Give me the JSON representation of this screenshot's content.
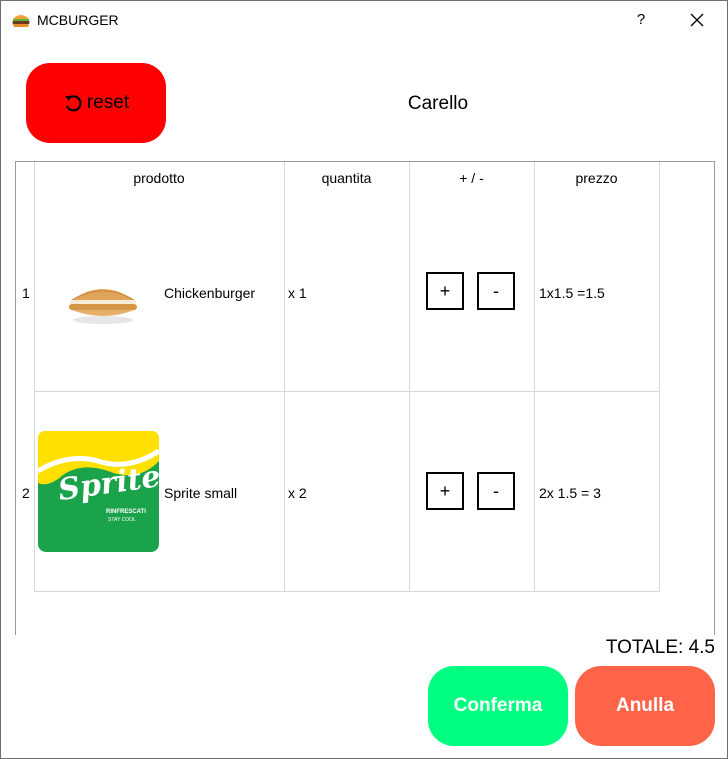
{
  "window": {
    "title": "MCBURGER",
    "help_label": "?",
    "icon": "burger-icon"
  },
  "header": {
    "reset_label": "reset",
    "reset_icon": "rotate-ccw-icon",
    "cart_title": "Carello"
  },
  "table": {
    "columns": [
      "prodotto",
      "quantita",
      "+ / -",
      "prezzo"
    ],
    "rows": [
      {
        "num": "1",
        "name": "Chickenburger",
        "image": "chicken-burger-image",
        "qty": "x 1",
        "plus": "+",
        "minus": "-",
        "price": "1x1.5 =1.5"
      },
      {
        "num": "2",
        "name": "Sprite small",
        "image": "sprite-can-image",
        "image_text": [
          "Sprite",
          "RINFRESCATI",
          "STAY COOL"
        ],
        "qty": "x 2",
        "plus": "+",
        "minus": "-",
        "price": "2x 1.5 = 3"
      }
    ]
  },
  "footer": {
    "total": "TOTALE: 4.5",
    "confirm_label": "Conferma",
    "cancel_label": "Anulla"
  },
  "colors": {
    "reset": "#ff0000",
    "confirm": "#00ff80",
    "cancel": "#ff6449",
    "sprite_green": "#1aa34a",
    "sprite_yellow": "#ffe000"
  }
}
